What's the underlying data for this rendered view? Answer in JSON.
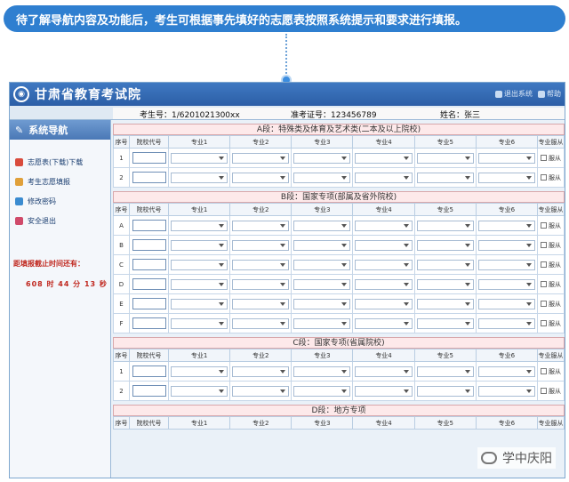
{
  "banner": {
    "text": "待了解导航内容及功能后，考生可根据事先填好的志愿表按照系统提示和要求进行填报。"
  },
  "app": {
    "title": "甘肃省教育考试院",
    "top_links": [
      "退出系统",
      "帮助"
    ]
  },
  "student": {
    "number_label": "考生号：",
    "number": "1/6201021300xx",
    "ticket_label": "准考证号：",
    "ticket": "123456789",
    "name_label": "姓名：",
    "name": "张三"
  },
  "nav": {
    "title": "系统导航",
    "items": [
      "志愿表(下载)下载",
      "考生志愿填报",
      "修改密码",
      "安全退出"
    ],
    "countdown_label": "距填报截止时间还有：",
    "countdown": "608 时 44 分 13 秒"
  },
  "columns": [
    "序号",
    "院校代号",
    "专业1",
    "专业2",
    "专业3",
    "专业4",
    "专业5",
    "专业6",
    "专业服从"
  ],
  "obey_label": "服从",
  "sections": [
    {
      "title": "A段：特殊类及体育及艺术类(二本及以上院校)",
      "rows": [
        "1",
        "2"
      ]
    },
    {
      "title": "B段：国家专项(部属及省外院校)",
      "rows": [
        "A",
        "B",
        "C",
        "D",
        "E",
        "F"
      ]
    },
    {
      "title": "C段：国家专项(省属院校)",
      "rows": [
        "1",
        "2"
      ]
    },
    {
      "title": "D段：地方专项",
      "rows": []
    }
  ],
  "watermark": {
    "text": "学中庆阳"
  }
}
